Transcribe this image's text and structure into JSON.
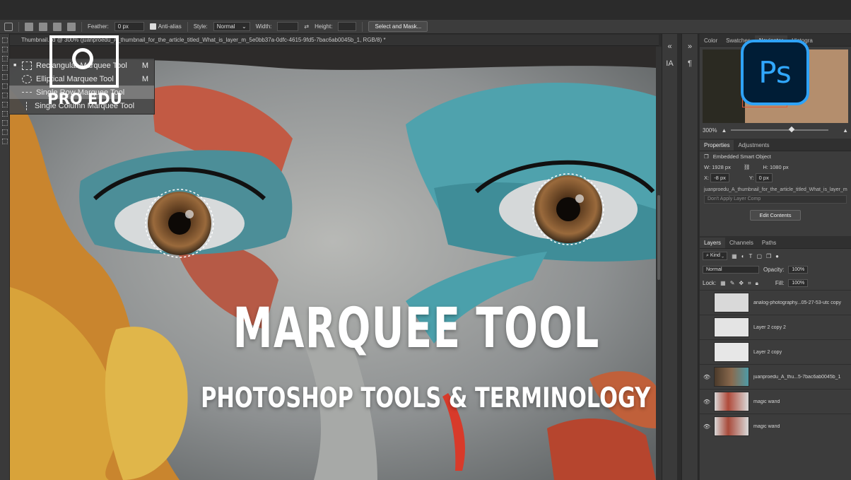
{
  "options_bar": {
    "feather_label": "Feather:",
    "feather_value": "0 px",
    "anti_alias_label": "Anti-alias",
    "style_label": "Style:",
    "style_value": "Normal",
    "width_label": "Width:",
    "height_label": "Height:",
    "select_mask_label": "Select and Mask..."
  },
  "document": {
    "tab_title": "Thumbnail...d @ 300% (juanproedu_A_thumbnail_for_the_article_titled_What_is_layer_m_5e0bb37a-0dfc-4615-9fd5-7bac6ab0045b_1, RGB/8) *"
  },
  "flyout": {
    "items": [
      {
        "label": "Rectangular Marquee Tool",
        "key": "M"
      },
      {
        "label": "Elliptical Marquee Tool",
        "key": "M"
      },
      {
        "label": "Single Row Marquee Tool",
        "key": ""
      },
      {
        "label": "Single Column Marquee Tool",
        "key": ""
      }
    ]
  },
  "logo": {
    "text": "PRO EDU"
  },
  "badge": {
    "text": "Ps"
  },
  "canvas": {
    "headline": "MARQUEE TOOL",
    "subheadline": "PHOTOSHOP TOOLS & TERMINOLOGY"
  },
  "right_panel": {
    "top_tabs": [
      "Color",
      "Swatches",
      "Navigator",
      "Histogra"
    ],
    "zoom": "300%",
    "prop_tabs": [
      "Properties",
      "Adjustments"
    ],
    "object_type": "Embedded Smart Object",
    "w_label": "W:",
    "w_value": "1928 px",
    "h_label": "H:",
    "h_value": "1080 px",
    "x_label": "X:",
    "x_value": "-8 px",
    "y_label": "Y:",
    "y_value": "0 px",
    "source_file": "juanproedu_A_thumbnail_for_the_article_titled_What_is_layer_m",
    "layer_comp": "Don't Apply Layer Comp",
    "edit_button": "Edit Contents",
    "layer_tabs": [
      "Layers",
      "Channels",
      "Paths"
    ],
    "kind_label": "Kind",
    "blend_mode": "Normal",
    "opacity_label": "Opacity:",
    "opacity_value": "100%",
    "lock_label": "Lock:",
    "fill_label": "Fill:",
    "fill_value": "100%",
    "layers": [
      {
        "name": "analog-photography...05-27-53-utc copy",
        "visible": false
      },
      {
        "name": "Layer 2 copy 2",
        "visible": false
      },
      {
        "name": "Layer 2 copy",
        "visible": false
      },
      {
        "name": "juanproedu_A_thu...5-7bac6ab0045b_1",
        "visible": true
      },
      {
        "name": "magic wand",
        "visible": true
      },
      {
        "name": "magic wand",
        "visible": true
      }
    ]
  },
  "colors": {
    "ps_blue": "#31a8ff",
    "ps_bg": "#001d36",
    "panel_bg": "#3c3c3c"
  }
}
